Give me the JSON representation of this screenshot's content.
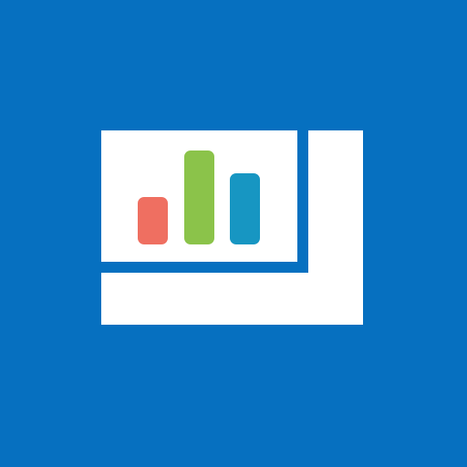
{
  "tile": {
    "background_color": "#0670c0"
  },
  "logo": {
    "icon": "bar-chart-logo-icon",
    "panel_color": "#ffffff",
    "bars": [
      {
        "name": "bar-red",
        "color": "#ef6f61",
        "level": 0.5
      },
      {
        "name": "bar-green",
        "color": "#8bc34a",
        "level": 1.0
      },
      {
        "name": "bar-blue",
        "color": "#1796c2",
        "level": 0.75
      }
    ]
  }
}
